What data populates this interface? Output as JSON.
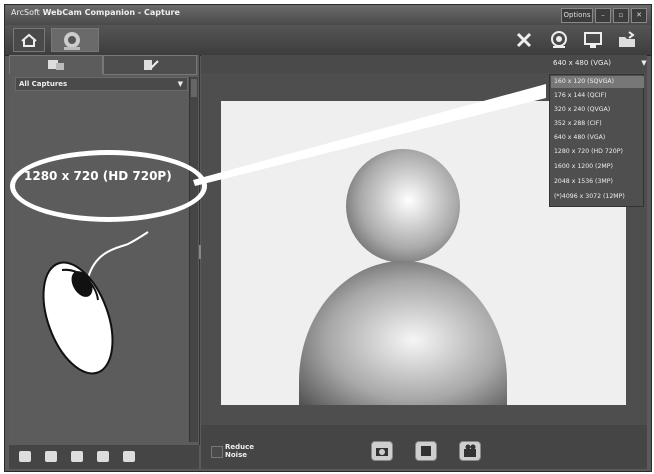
{
  "window": {
    "brand": "ArcSoft",
    "title": "WebCam Companion - Capture",
    "options_label": "Options",
    "minimize": "–",
    "maximize": "▫",
    "close": "✕"
  },
  "left_panel": {
    "filter_label": "All Captures",
    "reduce_noise_label": "Reduce Noise"
  },
  "resolution": {
    "current": "640 x 480 (VGA)",
    "options": [
      "160 x 120 (SQVGA)",
      "176 x 144 (QCIF)",
      "320 x 240 (QVGA)",
      "352 x 288 (CIF)",
      "640 x 480 (VGA)",
      "1280 x 720 (HD 720P)",
      "1600 x 1200 (2MP)",
      "2048 x 1536 (3MP)",
      "(*)4096 x 3072 (12MP)"
    ]
  },
  "callout": {
    "text": "1280 x 720 (HD 720P)"
  }
}
